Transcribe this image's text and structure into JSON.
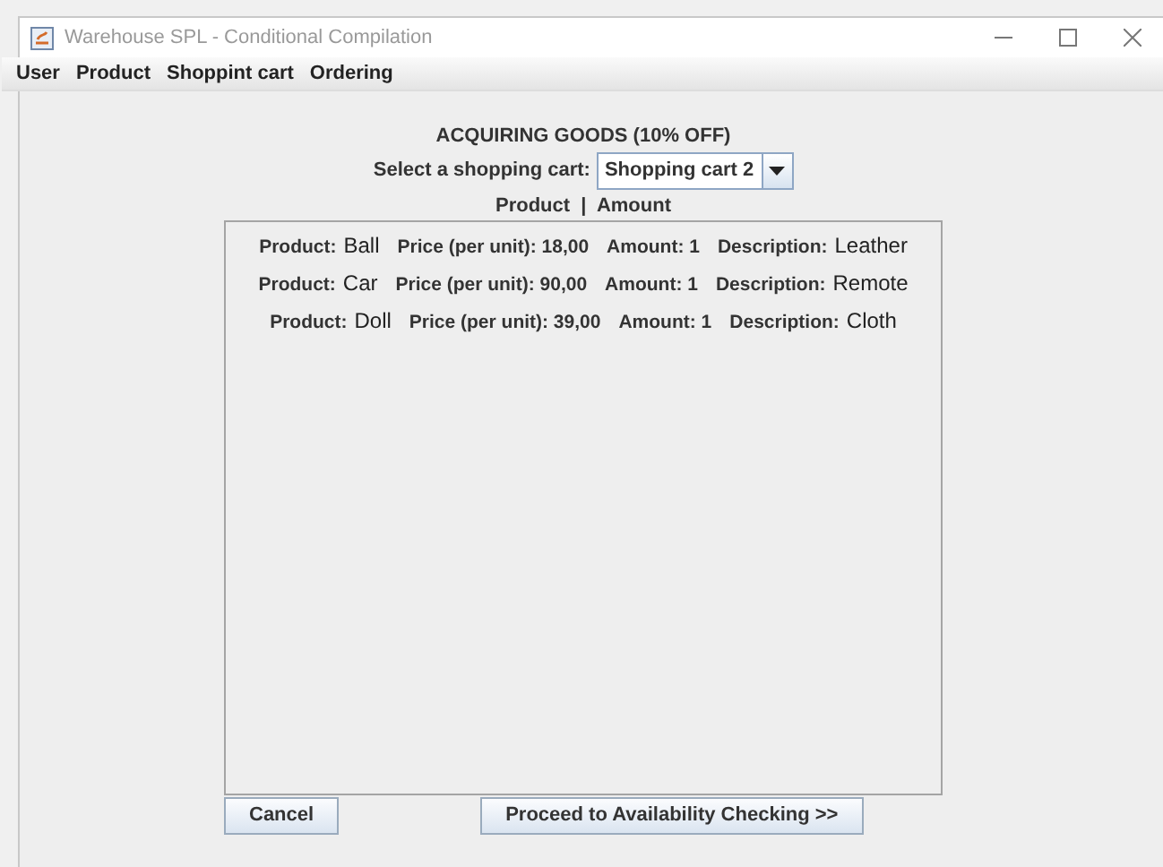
{
  "window": {
    "title": "Warehouse SPL - Conditional Compilation"
  },
  "menu": [
    "User",
    "Product",
    "Shoppint cart",
    "Ordering"
  ],
  "heading": "ACQUIRING GOODS (10% OFF)",
  "cart_select": {
    "label": "Select a shopping cart:",
    "value": "Shopping cart 2"
  },
  "list_header": "Product  |  Amount",
  "rows": [
    {
      "product_label": "Product:",
      "product": "Ball",
      "price": "Price (per unit): 18,00",
      "amount": "Amount: 1",
      "description_label": "Description:",
      "description": "Leather"
    },
    {
      "product_label": "Product:",
      "product": "Car",
      "price": "Price (per unit): 90,00",
      "amount": "Amount: 1",
      "description_label": "Description:",
      "description": "Remote"
    },
    {
      "product_label": "Product:",
      "product": "Doll",
      "price": "Price (per unit): 39,00",
      "amount": "Amount: 1",
      "description_label": "Description:",
      "description": "Cloth"
    }
  ],
  "buttons": {
    "cancel": "Cancel",
    "proceed": "Proceed to Availability Checking >>"
  }
}
